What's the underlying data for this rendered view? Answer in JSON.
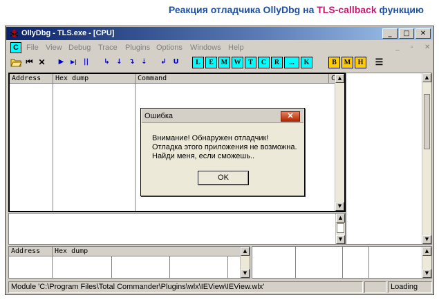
{
  "caption": {
    "prefix": "Реакция отладчика OllyDbg на ",
    "highlight": "TLS-callback",
    "suffix": " функцию"
  },
  "window": {
    "title": "OllyDbg - TLS.exe - [CPU]",
    "controls": {
      "minimize": "_",
      "maximize": "□",
      "close": "✕"
    }
  },
  "menu": {
    "c_button": "C",
    "items": [
      "File",
      "View",
      "Debug",
      "Trace",
      "Plugins",
      "Options",
      "Windows",
      "Help"
    ],
    "mdi": {
      "minimize": "_",
      "restore": "▫",
      "close": "✕"
    }
  },
  "toolbar": {
    "letters": [
      "L",
      "E",
      "M",
      "W",
      "T",
      "C",
      "R",
      "...",
      "K"
    ],
    "yellow": [
      "B",
      "M",
      "H"
    ],
    "blue_glyphs": [
      "▶",
      "▶|",
      "||",
      "↳",
      "↓",
      "↴",
      "⇣",
      "↲",
      "U"
    ]
  },
  "cpu_pane": {
    "headers": [
      "Address",
      "Hex dump",
      "Command",
      "C"
    ]
  },
  "dump_pane": {
    "headers": [
      "Address",
      "Hex dump"
    ]
  },
  "status": {
    "message": "Module 'C:\\Program Files\\Total Commander\\Plugins\\wlx\\IEView\\IEView.wlx'",
    "state": "Loading"
  },
  "dialog": {
    "title": "Ошибка",
    "close": "✕",
    "lines": [
      "Внимание! Обнаружен отладчик!",
      "Отладка этого приложения не возможна.",
      "Найди меня, если сможешь.."
    ],
    "ok_label": "OK"
  }
}
